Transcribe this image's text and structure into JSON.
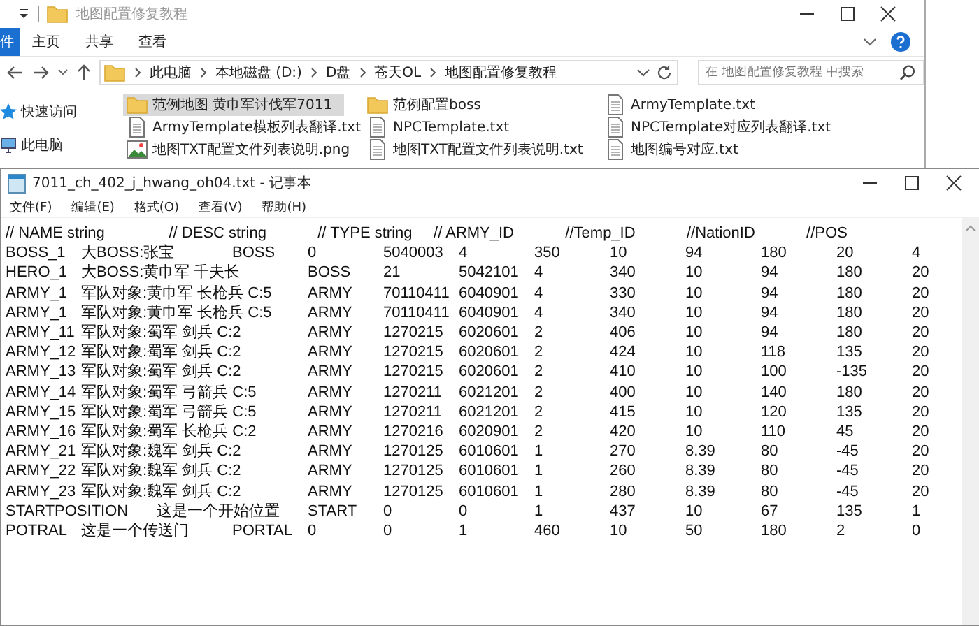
{
  "explorer": {
    "title": "地图配置修复教程",
    "ribbon_tabs": [
      {
        "label": "件",
        "selected": true
      },
      {
        "label": "主页",
        "selected": false
      },
      {
        "label": "共享",
        "selected": false
      },
      {
        "label": "查看",
        "selected": false
      }
    ],
    "breadcrumb": [
      "此电脑",
      "本地磁盘 (D:)",
      "D盘",
      "苍天OL",
      "地图配置修复教程"
    ],
    "search": {
      "placeholder": "在 地图配置修复教程 中搜索"
    },
    "nav": [
      {
        "label": "快速访问",
        "kind": "star"
      },
      {
        "label": "此电脑",
        "kind": "computer"
      }
    ],
    "files": [
      {
        "name": "范例地图 黄巾军讨伐军7011",
        "kind": "folder",
        "selected": true
      },
      {
        "name": "范例配置boss",
        "kind": "folder",
        "selected": false
      },
      {
        "name": "ArmyTemplate.txt",
        "kind": "text",
        "selected": false
      },
      {
        "name": "ArmyTemplate模板列表翻译.txt",
        "kind": "text",
        "selected": false
      },
      {
        "name": "NPCTemplate.txt",
        "kind": "text",
        "selected": false
      },
      {
        "name": "NPCTemplate对应列表翻译.txt",
        "kind": "text",
        "selected": false
      },
      {
        "name": "地图TXT配置文件列表说明.png",
        "kind": "image",
        "selected": false
      },
      {
        "name": "地图TXT配置文件列表说明.txt",
        "kind": "text",
        "selected": false
      },
      {
        "name": "地图编号对应.txt",
        "kind": "text",
        "selected": false
      }
    ]
  },
  "notepad": {
    "title": "7011_ch_402_j_hwang_oh04.txt - 记事本",
    "menu": [
      "文件(F)",
      "编辑(E)",
      "格式(O)",
      "查看(V)",
      "帮助(H)"
    ],
    "lines": [
      "// NAME string               // DESC string            // TYPE string     // ARMY_ID            //Temp_ID            //NationID            //POS",
      "BOSS_1\t大BOSS:张宝\tBOSS\t0\t5040003\t4\t350\t10\t94\t180\t20\t4",
      "HERO_1\t大BOSS:黄巾军 千夫长\tBOSS\t21\t5042101\t4\t340\t10\t94\t180\t20",
      "ARMY_1\t军队对象:黄巾军 长枪兵 C:5\tARMY\t70110411\t6040901\t4\t330\t10\t94\t180\t20",
      "ARMY_1\t军队对象:黄巾军 长枪兵 C:5\tARMY\t70110411\t6040901\t4\t340\t10\t94\t180\t20",
      "ARMY_11\t军队对象:蜀军 剑兵 C:2\tARMY\t1270215\t6020601\t2\t406\t10\t94\t180\t20",
      "ARMY_12\t军队对象:蜀军 剑兵 C:2\tARMY\t1270215\t6020601\t2\t424\t10\t118\t135\t20",
      "ARMY_13\t军队对象:蜀军 剑兵 C:2\tARMY\t1270215\t6020601\t2\t410\t10\t100\t-135\t20",
      "ARMY_14\t军队对象:蜀军 弓箭兵 C:5\tARMY\t1270211\t6021201\t2\t400\t10\t140\t180\t20",
      "ARMY_15\t军队对象:蜀军 弓箭兵 C:5\tARMY\t1270211\t6021201\t2\t415\t10\t120\t135\t20",
      "ARMY_16\t军队对象:蜀军 长枪兵 C:2\tARMY\t1270216\t6020901\t2\t420\t10\t110\t45\t20",
      "ARMY_21\t军队对象:魏军 剑兵 C:2\tARMY\t1270125\t6010601\t1\t270\t8.39\t80\t-45\t20",
      "ARMY_22\t军队对象:魏军 剑兵 C:2\tARMY\t1270125\t6010601\t1\t260\t8.39\t80\t-45\t20",
      "ARMY_23\t军队对象:魏军 剑兵 C:2\tARMY\t1270125\t6010601\t1\t280\t8.39\t80\t-45\t20",
      "STARTPOSITION\t这是一个开始位置\tSTART\t0\t0\t1\t437\t10\t67\t135\t1",
      "POTRAL\t这是一个传送门\tPORTAL\t0\t0\t1\t460\t10\t50\t180\t2\t0"
    ]
  }
}
